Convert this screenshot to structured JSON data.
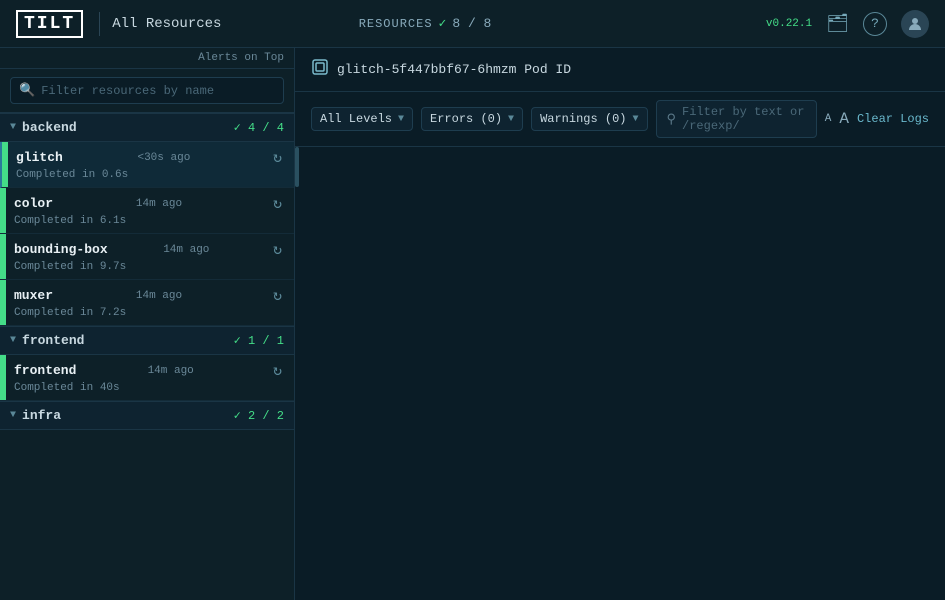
{
  "topnav": {
    "logo": "TILT",
    "title": "All Resources",
    "resources_label": "RESOURCES",
    "resources_check": "✓",
    "resources_count": "8 / 8",
    "version": "v0.22.1",
    "book_icon": "📋",
    "help_icon": "?",
    "user_icon": "👤"
  },
  "sidebar": {
    "alerts_top_label": "Alerts on Top",
    "search_placeholder": "Filter resources by name",
    "groups": [
      {
        "id": "backend",
        "name": "backend",
        "count": "✓ 4 / 4",
        "items": [
          {
            "id": "glitch",
            "name": "glitch",
            "time": "<30s ago",
            "status": "green",
            "detail": "Completed in 0.6s",
            "active": true
          },
          {
            "id": "color",
            "name": "color",
            "time": "14m ago",
            "status": "green",
            "detail": "Completed in 6.1s",
            "active": false
          },
          {
            "id": "bounding-box",
            "name": "bounding-box",
            "time": "14m ago",
            "status": "green",
            "detail": "Completed in 9.7s",
            "active": false
          },
          {
            "id": "muxer",
            "name": "muxer",
            "time": "14m ago",
            "status": "green",
            "detail": "Completed in 7.2s",
            "active": false
          }
        ]
      },
      {
        "id": "frontend",
        "name": "frontend",
        "count": "✓ 1 / 1",
        "items": [
          {
            "id": "frontend-item",
            "name": "frontend",
            "time": "14m ago",
            "status": "green",
            "detail": "Completed in 40s",
            "active": false
          }
        ]
      },
      {
        "id": "infra",
        "name": "infra",
        "count": "✓ 2 / 2",
        "items": []
      }
    ]
  },
  "content": {
    "pod_icon": "⧉",
    "pod_id": "glitch-5f447bbf67-6hmzm Pod ID",
    "log_levels": {
      "all_levels": "All Levels",
      "errors": "Errors (0)",
      "warnings": "Warnings (0)"
    },
    "filter_placeholder": "Filter by text or /regexp/",
    "font_size_small": "A",
    "font_size_large": "A",
    "clear_logs": "Clear Logs"
  }
}
